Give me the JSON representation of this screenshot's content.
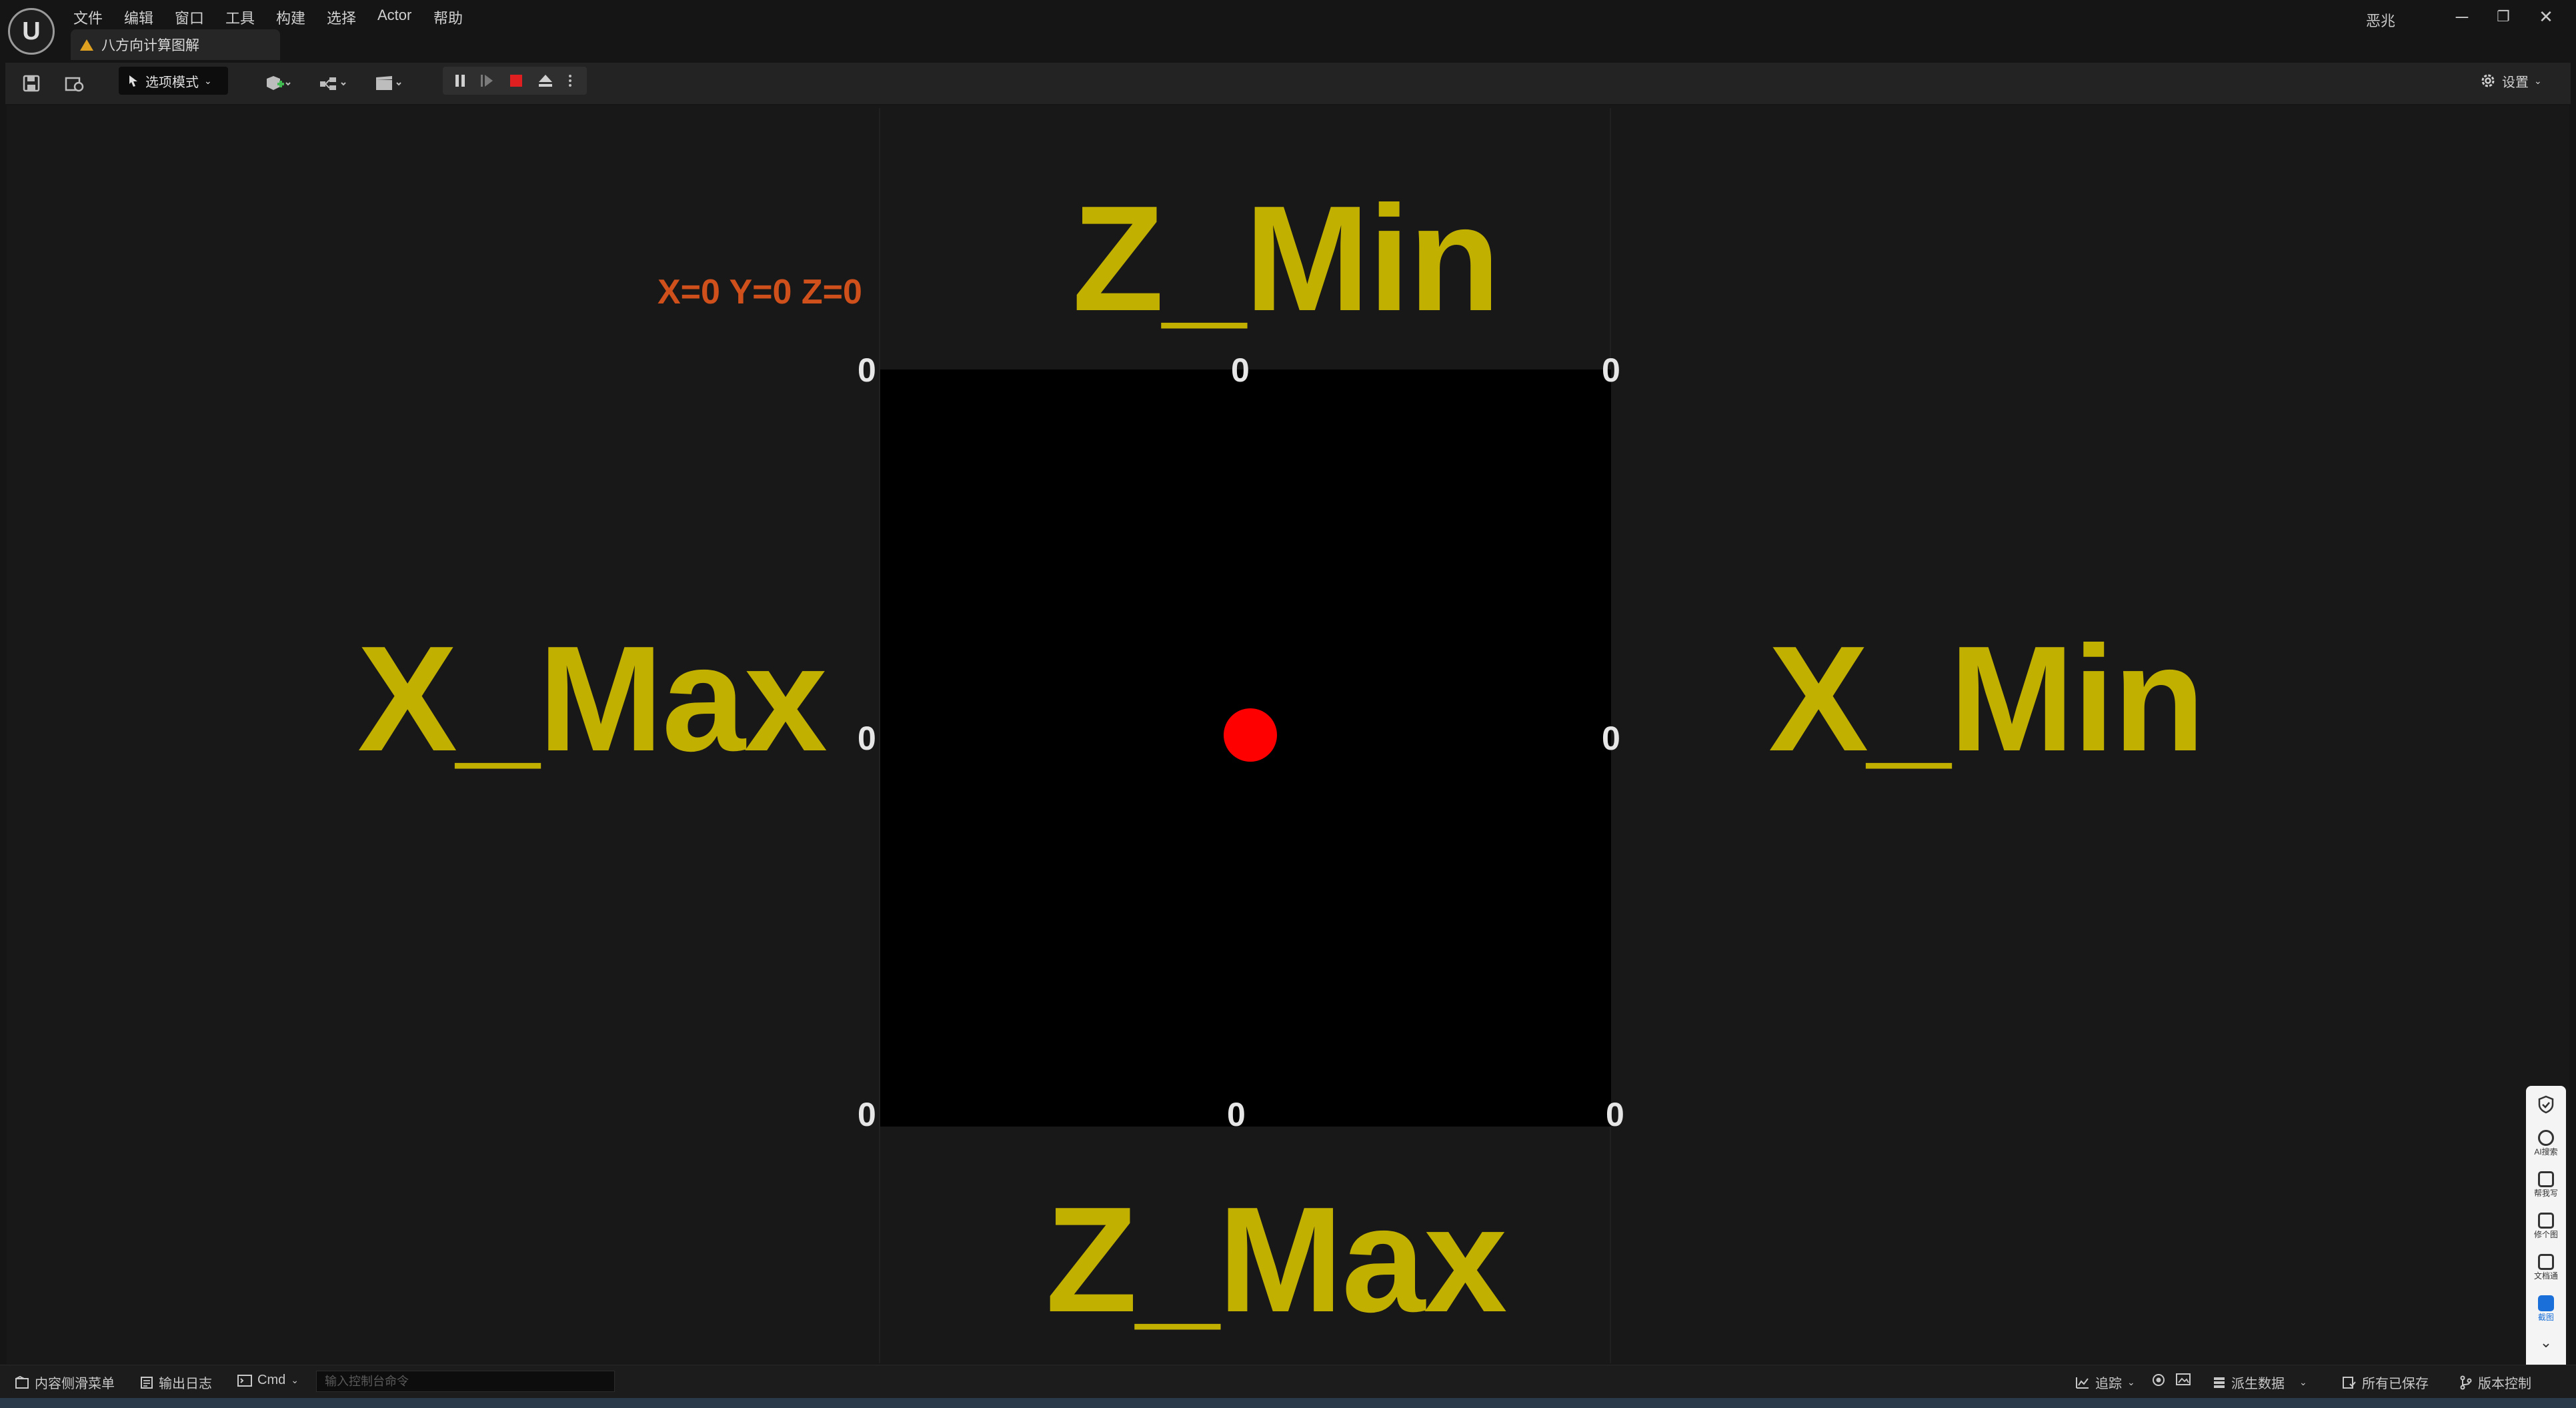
{
  "app": {
    "logo_text": "U",
    "menu": [
      "文件",
      "编辑",
      "窗口",
      "工具",
      "构建",
      "选择",
      "Actor",
      "帮助"
    ],
    "document_tab": "八方向计算图解",
    "user": "恶兆",
    "window_controls": [
      "─",
      "❐",
      "✕"
    ]
  },
  "toolbar": {
    "save_icon": "save-icon",
    "mode_label": "选项模式",
    "settings_label": "设置",
    "play_controls": [
      "pause",
      "step",
      "stop",
      "eject",
      "more"
    ],
    "stop_color": "#e02020"
  },
  "viewport": {
    "coord_label": "X=0 Y=0 Z=0",
    "labels": {
      "z_min": "Z_Min",
      "z_max": "Z_Max",
      "x_max": "X_Max",
      "x_min": "X_Min"
    },
    "grid_values": {
      "top_left": "0",
      "top_center": "0",
      "top_right": "0",
      "mid_left": "0",
      "mid_right": "0",
      "bottom_left": "0",
      "bottom_center": "0",
      "bottom_right": "0"
    },
    "label_color": "#c2b000",
    "dot_color": "#ff0000"
  },
  "side_panel": {
    "items": [
      "AI搜索",
      "帮我写",
      "修个图",
      "文档通",
      "截图"
    ]
  },
  "statusbar": {
    "content_drawer": "内容侧滑菜单",
    "output_log": "输出日志",
    "cmd": "Cmd",
    "cmd_placeholder": "输入控制台命令",
    "trace": "追踪",
    "derived_data": "派生数据",
    "all_saved": "所有已保存",
    "source_control": "版本控制"
  }
}
